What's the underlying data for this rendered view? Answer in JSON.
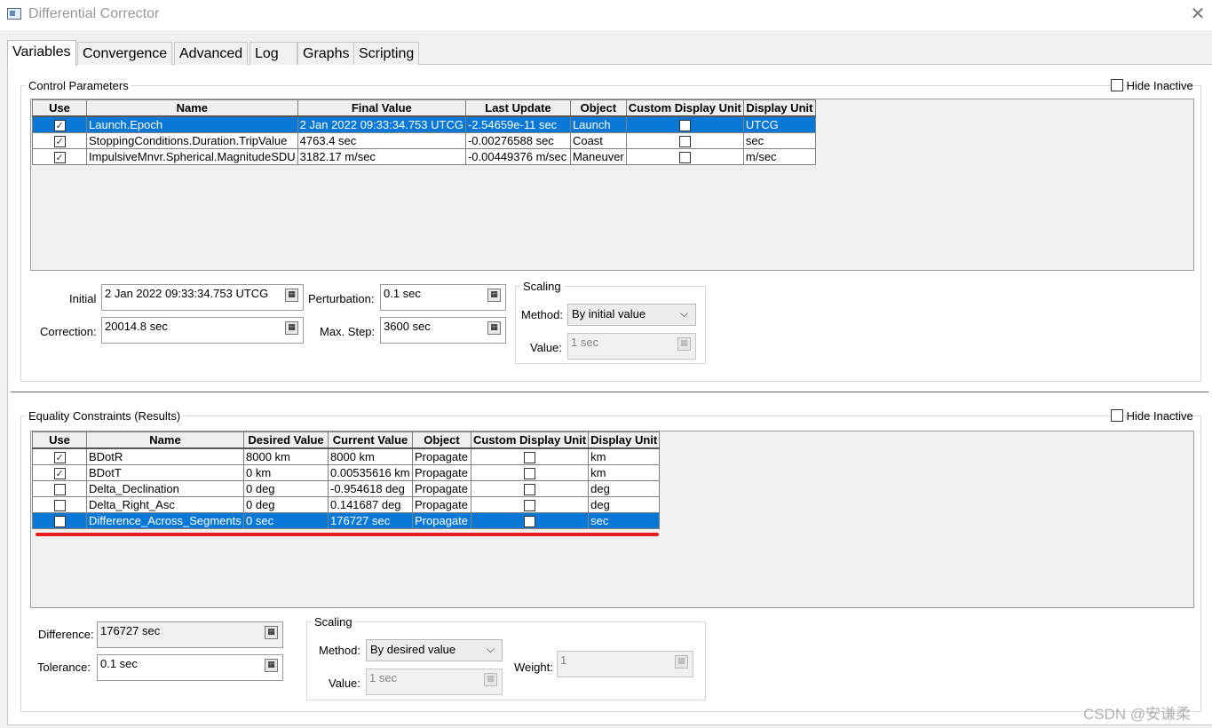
{
  "window": {
    "title": "Differential Corrector",
    "close_glyph": "✕"
  },
  "tabs": [
    "Variables",
    "Convergence",
    "Advanced",
    "Log",
    "Graphs",
    "Scripting"
  ],
  "control_parameters": {
    "title": "Control Parameters",
    "hide_inactive": "Hide Inactive",
    "columns": [
      "Use",
      "Name",
      "Final Value",
      "Last Update",
      "Object",
      "Custom Display Unit",
      "Display Unit"
    ],
    "rows": [
      {
        "use": true,
        "name": "Launch.Epoch",
        "final_value": "2 Jan 2022 09:33:34.753 UTCG",
        "last_update": "-2.54659e-11 sec",
        "object": "Launch",
        "custom": false,
        "unit": "UTCG",
        "selected": true
      },
      {
        "use": true,
        "name": "StoppingConditions.Duration.TripValue",
        "final_value": "4763.4 sec",
        "last_update": "-0.00276588 sec",
        "object": "Coast",
        "custom": false,
        "unit": "sec",
        "selected": false
      },
      {
        "use": true,
        "name": "ImpulsiveMnvr.Spherical.MagnitudeSDU",
        "final_value": "3182.17 m/sec",
        "last_update": "-0.00449376 m/sec",
        "object": "Maneuver",
        "custom": false,
        "unit": "m/sec",
        "selected": false
      }
    ],
    "initial_label": "Initial",
    "initial_value": "2 Jan 2022 09:33:34.753 UTCG",
    "correction_label": "Correction:",
    "correction_value": "20014.8 sec",
    "perturbation_label": "Perturbation:",
    "perturbation_value": "0.1 sec",
    "max_step_label": "Max. Step:",
    "max_step_value": "3600 sec",
    "scaling": {
      "title": "Scaling",
      "method_label": "Method:",
      "method_value": "By initial value",
      "value_label": "Value:",
      "value_value": "1 sec"
    }
  },
  "equality_constraints": {
    "title": "Equality Constraints (Results)",
    "hide_inactive": "Hide Inactive",
    "columns": [
      "Use",
      "Name",
      "Desired Value",
      "Current Value",
      "Object",
      "Custom Display Unit",
      "Display Unit"
    ],
    "rows": [
      {
        "use": true,
        "name": "BDotR",
        "desired": "8000 km",
        "current": "8000 km",
        "object": "Propagate",
        "custom": false,
        "unit": "km",
        "selected": false
      },
      {
        "use": true,
        "name": "BDotT",
        "desired": "0 km",
        "current": "0.00535616 km",
        "object": "Propagate",
        "custom": false,
        "unit": "km",
        "selected": false
      },
      {
        "use": false,
        "name": "Delta_Declination",
        "desired": "0 deg",
        "current": "-0.954618 deg",
        "object": "Propagate",
        "custom": false,
        "unit": "deg",
        "selected": false
      },
      {
        "use": false,
        "name": "Delta_Right_Asc",
        "desired": "0 deg",
        "current": "0.141687 deg",
        "object": "Propagate",
        "custom": false,
        "unit": "deg",
        "selected": false
      },
      {
        "use": false,
        "name": "Difference_Across_Segments",
        "desired": "0 sec",
        "current": "176727 sec",
        "object": "Propagate",
        "custom": false,
        "unit": "sec",
        "selected": true
      }
    ],
    "difference_label": "Difference:",
    "difference_value": "176727 sec",
    "tolerance_label": "Tolerance:",
    "tolerance_value": "0.1 sec",
    "scaling": {
      "title": "Scaling",
      "method_label": "Method:",
      "method_value": "By desired value",
      "value_label": "Value:",
      "value_value": "1 sec",
      "weight_label": "Weight:",
      "weight_value": "1"
    }
  },
  "watermark": "CSDN @安谦柔",
  "colors": {
    "selection": "#0a78d7",
    "annotation_underline": "#e81c1c"
  },
  "icons": {
    "field_button": "calculator-icon",
    "dropdown": "chevron-down-icon"
  }
}
